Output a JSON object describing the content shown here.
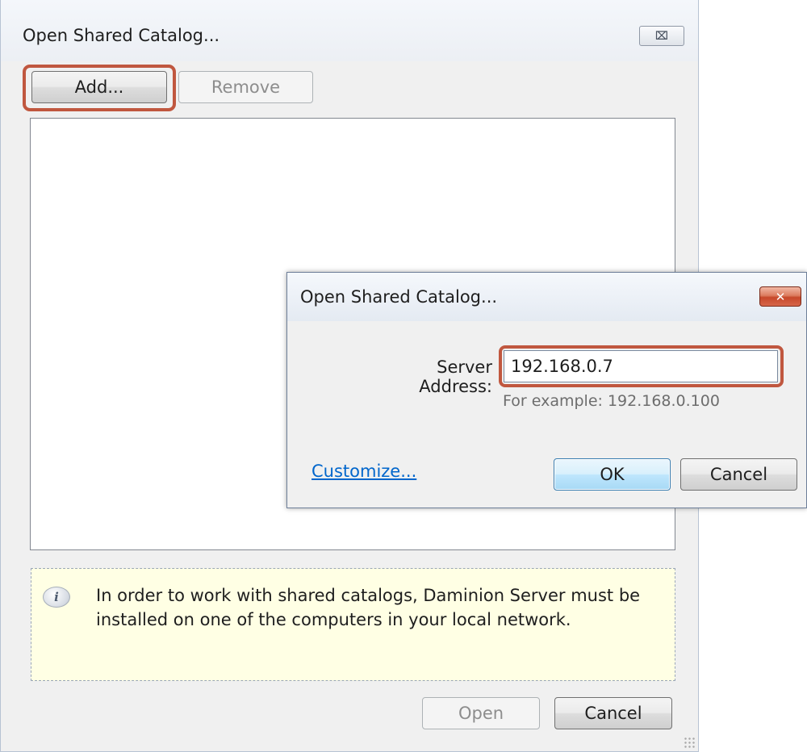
{
  "main_dialog": {
    "title": "Open Shared Catalog...",
    "close_glyph": "⌧",
    "add_label": "Add...",
    "remove_label": "Remove",
    "info_icon_glyph": "i",
    "info_text": "In order to work with shared catalogs, Daminion Server must be installed on one of the computers in your local network.",
    "open_label": "Open",
    "cancel_label": "Cancel"
  },
  "server_dialog": {
    "title": "Open Shared Catalog...",
    "close_glyph": "✕",
    "server_label": "Server Address:",
    "server_value": "192.168.0.7",
    "hint": "For example: 192.168.0.100",
    "customize_label": "Customize...",
    "ok_label": "OK",
    "cancel_label": "Cancel"
  },
  "colors": {
    "highlight": "#c0573f",
    "link": "#0066cc",
    "info_background": "#ffffe4",
    "dialog_background": "#f0f0f0"
  }
}
